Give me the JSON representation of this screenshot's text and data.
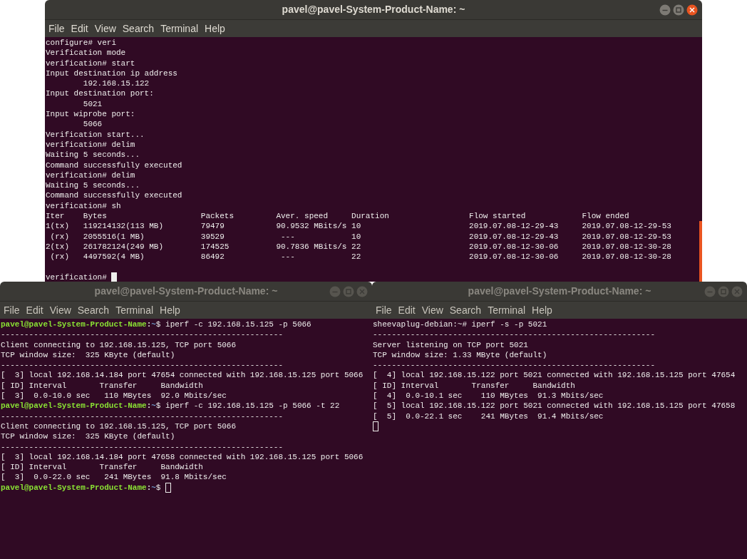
{
  "windows": [
    {
      "title": "pavel@pavel-System-Product-Name: ~",
      "focused": true,
      "menu": [
        "File",
        "Edit",
        "View",
        "Search",
        "Terminal",
        "Help"
      ],
      "lines": [
        {
          "kind": "text",
          "text": "configure# veri"
        },
        {
          "kind": "text",
          "text": "Verification mode"
        },
        {
          "kind": "text",
          "text": "verification# start"
        },
        {
          "kind": "text",
          "text": "Input destination ip address"
        },
        {
          "kind": "text",
          "text": "        192.168.15.122"
        },
        {
          "kind": "text",
          "text": "Input destination port:"
        },
        {
          "kind": "text",
          "text": "        5021"
        },
        {
          "kind": "text",
          "text": "Input wiprobe port:"
        },
        {
          "kind": "text",
          "text": "        5066"
        },
        {
          "kind": "text",
          "text": "Verification start..."
        },
        {
          "kind": "text",
          "text": "verification# delim"
        },
        {
          "kind": "text",
          "text": "Waiting 5 seconds..."
        },
        {
          "kind": "text",
          "text": "Command successfully executed"
        },
        {
          "kind": "text",
          "text": "verification# delim"
        },
        {
          "kind": "text",
          "text": "Waiting 5 seconds..."
        },
        {
          "kind": "text",
          "text": "Command successfully executed"
        },
        {
          "kind": "text",
          "text": "verification# sh"
        },
        {
          "kind": "table",
          "columns": [
            "Iter",
            "Bytes",
            "Packets",
            "Aver. speed",
            "Duration",
            "Flow started",
            "Flow ended"
          ],
          "rows": [
            [
              "1(tx)",
              "119214132(113 MB)",
              "79479",
              "90.9532 MBits/s",
              "10",
              "2019.07.08-12-29-43",
              "2019.07.08-12-29-53"
            ],
            [
              " (rx)",
              "2055516(1 MB)",
              "39529",
              " ---",
              "10",
              "2019.07.08-12-29-43",
              "2019.07.08-12-29-53"
            ],
            [
              "2(tx)",
              "261782124(249 MB)",
              "174525",
              "90.7836 MBits/s",
              "22",
              "2019.07.08-12-30-06",
              "2019.07.08-12-30-28"
            ],
            [
              " (rx)",
              "4497592(4 MB)",
              "86492",
              " ---",
              "22",
              "2019.07.08-12-30-06",
              "2019.07.08-12-30-28"
            ]
          ]
        },
        {
          "kind": "blank"
        },
        {
          "kind": "text",
          "text": "verification#",
          "cursor": true
        }
      ]
    },
    {
      "title": "pavel@pavel-System-Product-Name: ~",
      "focused": false,
      "menu": [
        "File",
        "Edit",
        "View",
        "Search",
        "Terminal",
        "Help"
      ],
      "lines": [
        {
          "kind": "prompt",
          "host": "pavel@pavel-System-Product-Name",
          "separator": ":",
          "path": "~",
          "symbol": "$",
          "command": "iperf -c 192.168.15.125 -p 5066"
        },
        {
          "kind": "text",
          "text": "------------------------------------------------------------"
        },
        {
          "kind": "text",
          "text": "Client connecting to 192.168.15.125, TCP port 5066"
        },
        {
          "kind": "text",
          "text": "TCP window size:  325 KByte (default)"
        },
        {
          "kind": "text",
          "text": "------------------------------------------------------------"
        },
        {
          "kind": "text",
          "text": "[  3] local 192.168.14.184 port 47654 connected with 192.168.15.125 port 5066"
        },
        {
          "kind": "text",
          "text": "[ ID] Interval       Transfer     Bandwidth"
        },
        {
          "kind": "text",
          "text": "[  3]  0.0-10.0 sec   110 MBytes  92.0 Mbits/sec"
        },
        {
          "kind": "prompt",
          "host": "pavel@pavel-System-Product-Name",
          "separator": ":",
          "path": "~",
          "symbol": "$",
          "command": "iperf -c 192.168.15.125 -p 5066 -t 22"
        },
        {
          "kind": "text",
          "text": "------------------------------------------------------------"
        },
        {
          "kind": "text",
          "text": "Client connecting to 192.168.15.125, TCP port 5066"
        },
        {
          "kind": "text",
          "text": "TCP window size:  325 KByte (default)"
        },
        {
          "kind": "text",
          "text": "------------------------------------------------------------"
        },
        {
          "kind": "text",
          "text": "[  3] local 192.168.14.184 port 47658 connected with 192.168.15.125 port 5066"
        },
        {
          "kind": "text",
          "text": "[ ID] Interval       Transfer     Bandwidth"
        },
        {
          "kind": "text",
          "text": "[  3]  0.0-22.0 sec   241 MBytes  91.8 Mbits/sec"
        },
        {
          "kind": "prompt",
          "host": "pavel@pavel-System-Product-Name",
          "separator": ":",
          "path": "~",
          "symbol": "$",
          "cursor": true
        }
      ]
    },
    {
      "title": "pavel@pavel-System-Product-Name: ~",
      "focused": false,
      "menu": [
        "File",
        "Edit",
        "View",
        "Search",
        "Terminal",
        "Help"
      ],
      "lines": [
        {
          "kind": "text",
          "text": "sheevaplug-debian:~# iperf -s -p 5021"
        },
        {
          "kind": "text",
          "text": "------------------------------------------------------------"
        },
        {
          "kind": "text",
          "text": "Server listening on TCP port 5021"
        },
        {
          "kind": "text",
          "text": "TCP window size: 1.33 MByte (default)"
        },
        {
          "kind": "text",
          "text": "------------------------------------------------------------"
        },
        {
          "kind": "text",
          "text": "[  4] local 192.168.15.122 port 5021 connected with 192.168.15.125 port 47654"
        },
        {
          "kind": "text",
          "text": "[ ID] Interval       Transfer     Bandwidth"
        },
        {
          "kind": "text",
          "text": "[  4]  0.0-10.1 sec    110 MBytes  91.3 Mbits/sec"
        },
        {
          "kind": "text",
          "text": "[  5] local 192.168.15.122 port 5021 connected with 192.168.15.125 port 47658"
        },
        {
          "kind": "text",
          "text": "[  5]  0.0-22.1 sec    241 MBytes  91.4 Mbits/sec"
        },
        {
          "kind": "cursor",
          "cursor": true
        }
      ]
    }
  ]
}
